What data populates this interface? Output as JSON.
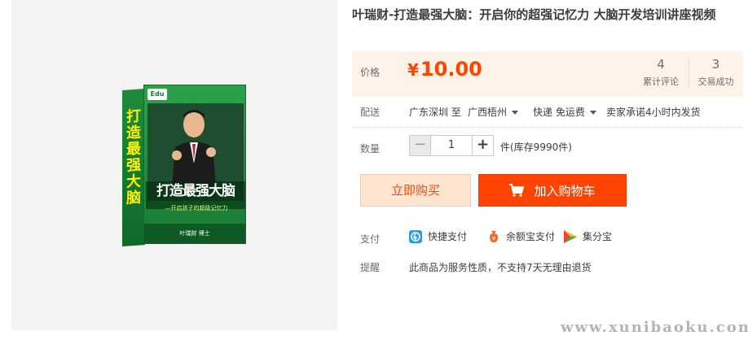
{
  "product": {
    "title": "叶瑞财-打造最强大脑：开启你的超强记忆力 大脑开发培训讲座视频",
    "image": {
      "spine_text": "打造最强大脑",
      "cover_title": "打造最强大脑",
      "cover_subtitle": "—开启孩子的超级记忆力",
      "cover_footer": "叶瑞财 博士",
      "logo": "Edu"
    }
  },
  "price": {
    "label": "价格",
    "currency": "¥",
    "value": "10.00",
    "color": "#ff4400"
  },
  "stats": [
    {
      "num": "4",
      "label": "累计评论"
    },
    {
      "num": "3",
      "label": "交易成功"
    }
  ],
  "shipping": {
    "label": "配送",
    "from": "广东深圳 至",
    "to": "广西梧州",
    "method": "快递 免运费",
    "promise": "卖家承诺4小时内发货"
  },
  "quantity": {
    "label": "数量",
    "value": "1",
    "minus": "−",
    "plus": "+",
    "stock": "件(库存9990件)"
  },
  "buttons": {
    "buy": "立即购买",
    "cart": "加入购物车",
    "cart_color": "#ff4400"
  },
  "payment": {
    "label": "支付",
    "methods": [
      {
        "name": "快捷支付",
        "icon": "quick-pay-icon"
      },
      {
        "name": "余额宝支付",
        "icon": "yuebao-icon"
      },
      {
        "name": "集分宝",
        "icon": "jifenbao-icon"
      }
    ]
  },
  "reminder": {
    "label": "提醒",
    "text": "此商品为服务性质，不支持7天无理由退货"
  },
  "watermark": "www.xunibaoku.com"
}
